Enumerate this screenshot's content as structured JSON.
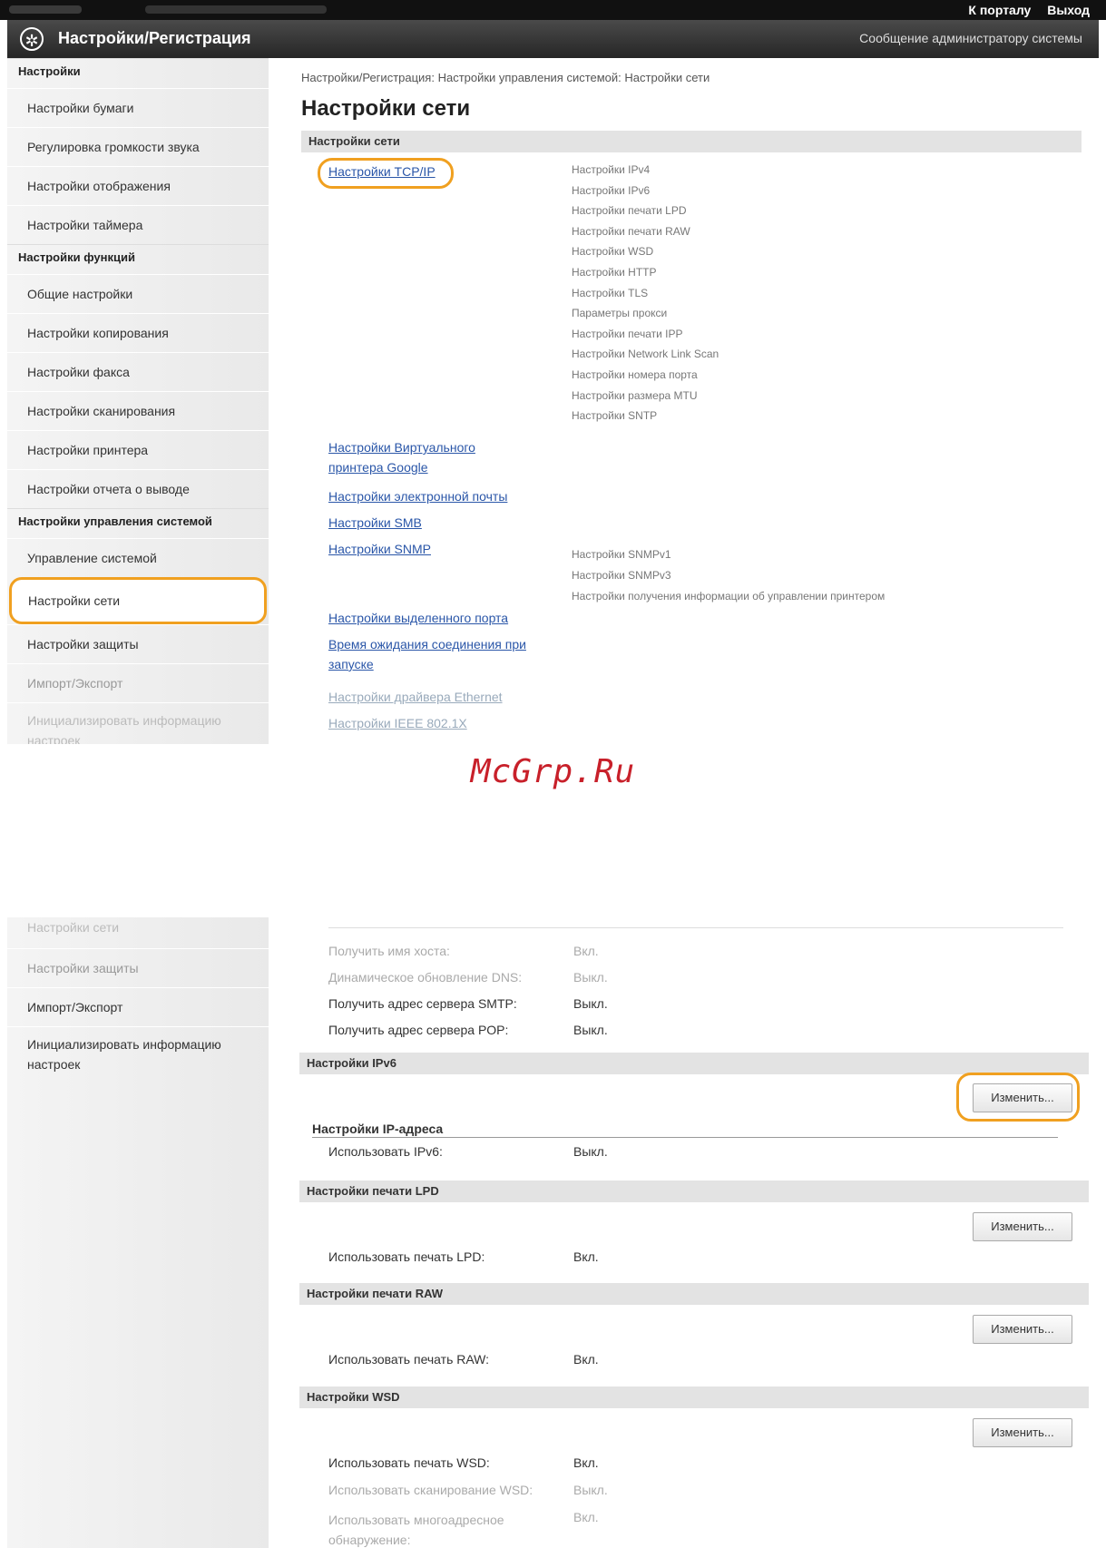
{
  "top": {
    "header": {
      "portal_link": "К порталу",
      "logout_link": "Выход",
      "app_title": "Настройки/Регистрация",
      "admin_link": "Сообщение администратору системы"
    },
    "sidebar": {
      "cat_settings": "Настройки",
      "items_a": [
        "Настройки бумаги",
        "Регулировка громкости звука",
        "Настройки отображения",
        "Настройки таймера"
      ],
      "cat_functions": "Настройки функций",
      "items_b": [
        "Общие настройки",
        "Настройки копирования",
        "Настройки факса",
        "Настройки сканирования",
        "Настройки принтера",
        "Настройки отчета о выводе"
      ],
      "cat_system": "Настройки управления системой",
      "items_c": [
        "Управление системой",
        "Настройки сети",
        "Настройки защиты",
        "Импорт/Экспорт",
        "Инициализировать информацию настроек"
      ]
    },
    "main": {
      "breadcrumb": "Настройки/Регистрация: Настройки управления системой: Настройки сети",
      "page_title": "Настройки сети",
      "section_header": "Настройки сети",
      "links": {
        "tcpip": "Настройки TCP/IP",
        "google": "Настройки Виртуального принтера Google",
        "email": "Настройки электронной почты",
        "smb": "Настройки SMB",
        "snmp": "Настройки SNMP",
        "port": "Настройки выделенного порта",
        "wait": "Время ожидания соединения при запуске",
        "ethernet": "Настройки драйвера Ethernet",
        "ieee": "Настройки IEEE 802.1X"
      },
      "tcpip_sub": [
        "Настройки IPv4",
        "Настройки IPv6",
        "Настройки печати LPD",
        "Настройки печати RAW",
        "Настройки WSD",
        "Настройки HTTP",
        "Настройки TLS",
        "Параметры прокси",
        "Настройки печати IPP",
        "Настройки Network Link Scan",
        "Настройки номера порта",
        "Настройки размера MTU",
        "Настройки SNTP"
      ],
      "snmp_sub": [
        "Настройки SNMPv1",
        "Настройки SNMPv3",
        "Настройки получения информации об управлении принтером"
      ]
    }
  },
  "watermark": "McGrp.Ru",
  "bottom": {
    "sidebar": [
      "Настройки сети",
      "Настройки защиты",
      "Импорт/Экспорт",
      "Инициализировать информацию настроек"
    ],
    "ipv4_rows": [
      {
        "k": "Получить имя хоста:",
        "v": "Вкл."
      },
      {
        "k": "Динамическое обновление DNS:",
        "v": "Выкл."
      },
      {
        "k": "Получить адрес сервера SMTP:",
        "v": "Выкл."
      },
      {
        "k": "Получить адрес сервера POP:",
        "v": "Выкл."
      }
    ],
    "ipv6": {
      "header": "Настройки IPv6",
      "button": "Изменить...",
      "subhead": "Настройки IP-адреса",
      "row": {
        "k": "Использовать IPv6:",
        "v": "Выкл."
      }
    },
    "lpd": {
      "header": "Настройки печати LPD",
      "button": "Изменить...",
      "row": {
        "k": "Использовать печать LPD:",
        "v": "Вкл."
      }
    },
    "raw": {
      "header": "Настройки печати RAW",
      "button": "Изменить...",
      "row": {
        "k": "Использовать печать RAW:",
        "v": "Вкл."
      }
    },
    "wsd": {
      "header": "Настройки WSD",
      "button": "Изменить...",
      "rows": [
        {
          "k": "Использовать печать WSD:",
          "v": "Вкл."
        },
        {
          "k": "Использовать сканирование WSD:",
          "v": "Выкл."
        },
        {
          "k": "Использовать многоадресное обнаружение:",
          "v": "Вкл."
        }
      ]
    }
  }
}
